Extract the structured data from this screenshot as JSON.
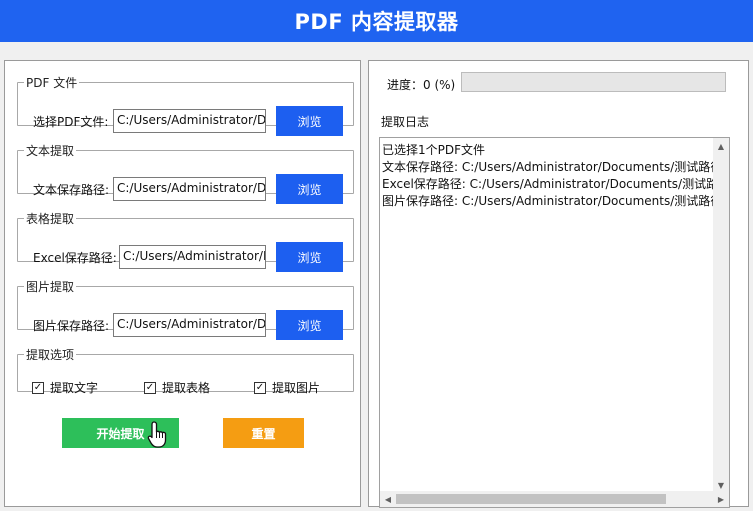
{
  "window": {
    "title": "PDF 内容提取器"
  },
  "pdf_group": {
    "legend": "PDF 文件",
    "label": "选择PDF文件:",
    "value": "C:/Users/Administrator/Do",
    "button": "浏览"
  },
  "text_group": {
    "legend": "文本提取",
    "label": "文本保存路径:",
    "value": "C:/Users/Administrator/Do",
    "button": "浏览"
  },
  "table_group": {
    "legend": "表格提取",
    "label": "Excel保存路径:",
    "value": "C:/Users/Administrator/Dc",
    "button": "浏览"
  },
  "image_group": {
    "legend": "图片提取",
    "label": "图片保存路径:",
    "value": "C:/Users/Administrator/Do",
    "button": "浏览"
  },
  "options": {
    "legend": "提取选项",
    "items": [
      {
        "label": "提取文字",
        "checked": true,
        "mark": "✓"
      },
      {
        "label": "提取表格",
        "checked": true,
        "mark": "✓"
      },
      {
        "label": "提取图片",
        "checked": true,
        "mark": "✓"
      }
    ]
  },
  "actions": {
    "start": "开始提取",
    "reset": "重置"
  },
  "progress": {
    "label": "进度：0 (%)",
    "value": 0
  },
  "log": {
    "title": "提取日志",
    "lines": [
      "已选择1个PDF文件",
      "文本保存路径: C:/Users/Administrator/Documents/测试路径/",
      "Excel保存路径: C:/Users/Administrator/Documents/测试路径/",
      "图片保存路径: C:/Users/Administrator/Documents/测试路径/i"
    ]
  },
  "colors": {
    "title_bar": "#1f63f0",
    "browse_button": "#1d5ff0",
    "start_button": "#2dbf5a",
    "reset_button": "#f59d12"
  },
  "icons": {
    "cursor": "hand-pointer-icon",
    "check": "checkmark-icon",
    "scroll_up": "arrow-up-icon",
    "scroll_down": "arrow-down-icon",
    "scroll_left": "arrow-left-icon",
    "scroll_right": "arrow-right-icon"
  }
}
